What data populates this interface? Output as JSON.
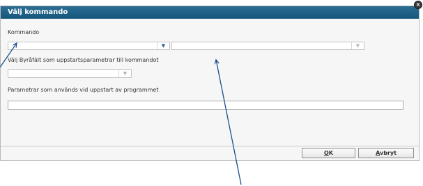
{
  "dialog": {
    "title": "Välj kommando",
    "close_icon": "close-icon"
  },
  "form": {
    "kommando_label": "Kommando",
    "byrafalt_label": "Välj Byråfält som uppstartsparametrar till kommandot",
    "parametrar_label": "Parametrar som används vid uppstart av programmet"
  },
  "buttons": {
    "ok_first": "O",
    "ok_rest": "K",
    "cancel_first": "A",
    "cancel_rest": "vbryt"
  },
  "icons": {
    "dropdown": "chevron-down-icon"
  }
}
